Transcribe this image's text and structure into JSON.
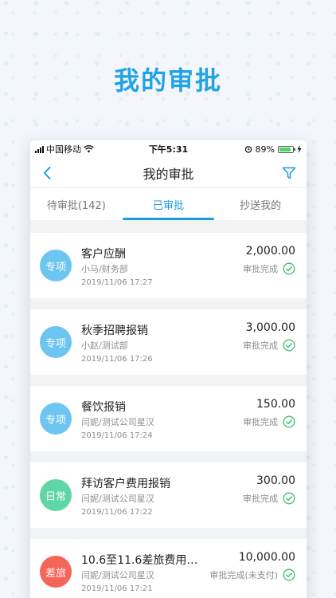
{
  "hero": {
    "title": "我的审批"
  },
  "status_bar": {
    "carrier": "中国移动",
    "time": "下午5:31",
    "battery": "89%",
    "battery_level": 0.89
  },
  "nav": {
    "title": "我的审批",
    "back_icon": "chevron-left-icon",
    "filter_icon": "filter-icon"
  },
  "tabs": [
    {
      "label": "待审批(142)",
      "active": false
    },
    {
      "label": "已审批",
      "active": true
    },
    {
      "label": "抄送我的",
      "active": false
    }
  ],
  "colors": {
    "accent": "#1a9be6",
    "tag_blue": "#6cc6f1",
    "tag_green": "#5fd6a6",
    "tag_red": "#f5655a",
    "check_green": "#3cbf6b"
  },
  "items": [
    {
      "tag": "专项",
      "tag_color": "#6cc6f1",
      "title": "客户应酬",
      "subtitle": "小马/财务部",
      "time": "2019/11/06 17:27",
      "amount": "2,000.00",
      "status": "审批完成"
    },
    {
      "tag": "专项",
      "tag_color": "#6cc6f1",
      "title": "秋季招聘报销",
      "subtitle": "小赵/测试部",
      "time": "2019/11/06 17:26",
      "amount": "3,000.00",
      "status": "审批完成"
    },
    {
      "tag": "专项",
      "tag_color": "#6cc6f1",
      "title": "餐饮报销",
      "subtitle": "闫妮/测试公司星汉",
      "time": "2019/11/06 17:24",
      "amount": "150.00",
      "status": "审批完成"
    },
    {
      "tag": "日常",
      "tag_color": "#5fd6a6",
      "title": "拜访客户费用报销",
      "subtitle": "闫妮/测试公司星汉",
      "time": "2019/11/06 17:22",
      "amount": "300.00",
      "status": "审批完成"
    },
    {
      "tag": "差旅",
      "tag_color": "#f5655a",
      "title": "10.6至11.6差旅费用…",
      "subtitle": "闫妮/测试公司星汉",
      "time": "2019/11/06 17:21",
      "amount": "10,000.00",
      "status": "审批完成(未支付)"
    }
  ]
}
